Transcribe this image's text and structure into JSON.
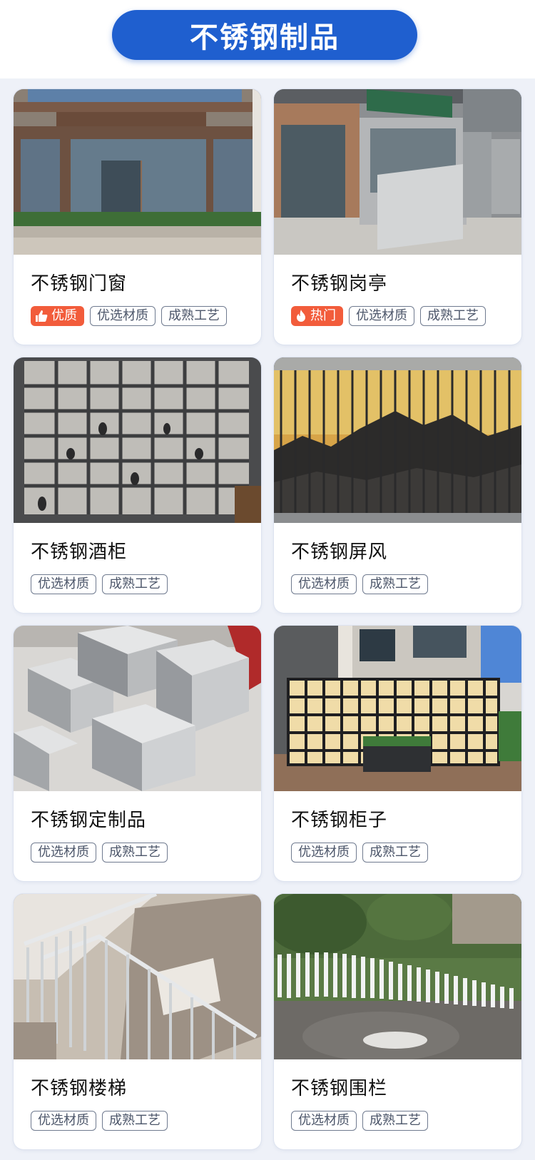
{
  "header": {
    "title": "不锈钢制品"
  },
  "products": [
    {
      "title": "不锈钢门窗",
      "badge": {
        "label": "优质",
        "icon": "thumbs-up-icon"
      },
      "tags": [
        "优选材质",
        "成熟工艺"
      ]
    },
    {
      "title": "不锈钢岗亭",
      "badge": {
        "label": "热门",
        "icon": "flame-icon"
      },
      "tags": [
        "优选材质",
        "成熟工艺"
      ]
    },
    {
      "title": "不锈钢酒柜",
      "tags": [
        "优选材质",
        "成熟工艺"
      ]
    },
    {
      "title": "不锈钢屏风",
      "tags": [
        "优选材质",
        "成熟工艺"
      ]
    },
    {
      "title": "不锈钢定制品",
      "tags": [
        "优选材质",
        "成熟工艺"
      ]
    },
    {
      "title": "不锈钢柜子",
      "tags": [
        "优选材质",
        "成熟工艺"
      ]
    },
    {
      "title": "不锈钢楼梯",
      "tags": [
        "优选材质",
        "成熟工艺"
      ]
    },
    {
      "title": "不锈钢围栏",
      "tags": [
        "优选材质",
        "成熟工艺"
      ]
    }
  ],
  "colors": {
    "accent": "#1f5fcf",
    "badge": "#f25c3b"
  }
}
